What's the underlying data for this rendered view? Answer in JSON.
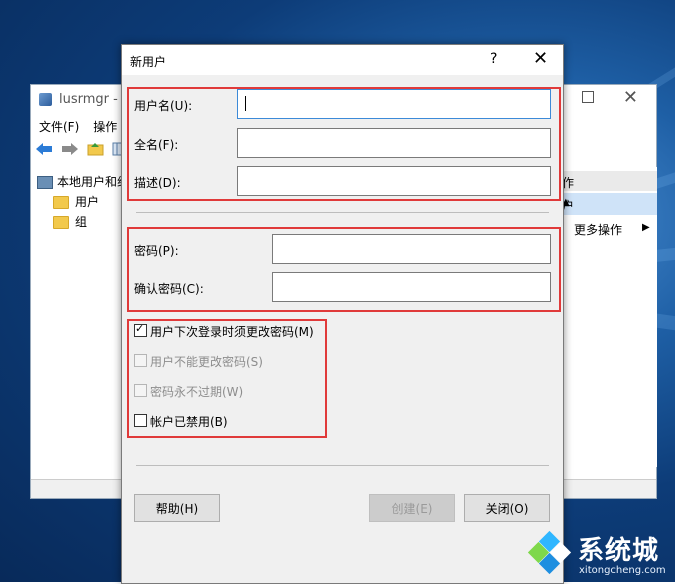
{
  "background_window": {
    "title": "lusrmgr - [",
    "menu": [
      "文件(F)",
      "操作"
    ],
    "tree": {
      "root": "本地用户和组",
      "items": [
        "用户",
        "组"
      ]
    },
    "actions": {
      "header": "作",
      "selected": "户",
      "more": "更多操作"
    }
  },
  "dialog": {
    "title": "新用户",
    "help_glyph": "?",
    "close_glyph": "✕",
    "fields": {
      "username": {
        "label": "用户名(U):",
        "value": ""
      },
      "fullname": {
        "label": "全名(F):",
        "value": ""
      },
      "description": {
        "label": "描述(D):",
        "value": ""
      },
      "password": {
        "label": "密码(P):",
        "value": ""
      },
      "confirm": {
        "label": "确认密码(C):",
        "value": ""
      }
    },
    "options": [
      {
        "label": "用户下次登录时须更改密码(M)",
        "checked": true,
        "enabled": true
      },
      {
        "label": "用户不能更改密码(S)",
        "checked": false,
        "enabled": false
      },
      {
        "label": "密码永不过期(W)",
        "checked": false,
        "enabled": false
      },
      {
        "label": "帐户已禁用(B)",
        "checked": false,
        "enabled": true
      }
    ],
    "buttons": {
      "help": "帮助(H)",
      "create": "创建(E)",
      "close": "关闭(O)"
    }
  },
  "watermark": {
    "brand": "系统城",
    "url": "xitongcheng.com"
  },
  "colors": {
    "highlight": "#e03a3a",
    "desktop": "#1e5fa5",
    "focus_border": "#3c8ad8"
  }
}
